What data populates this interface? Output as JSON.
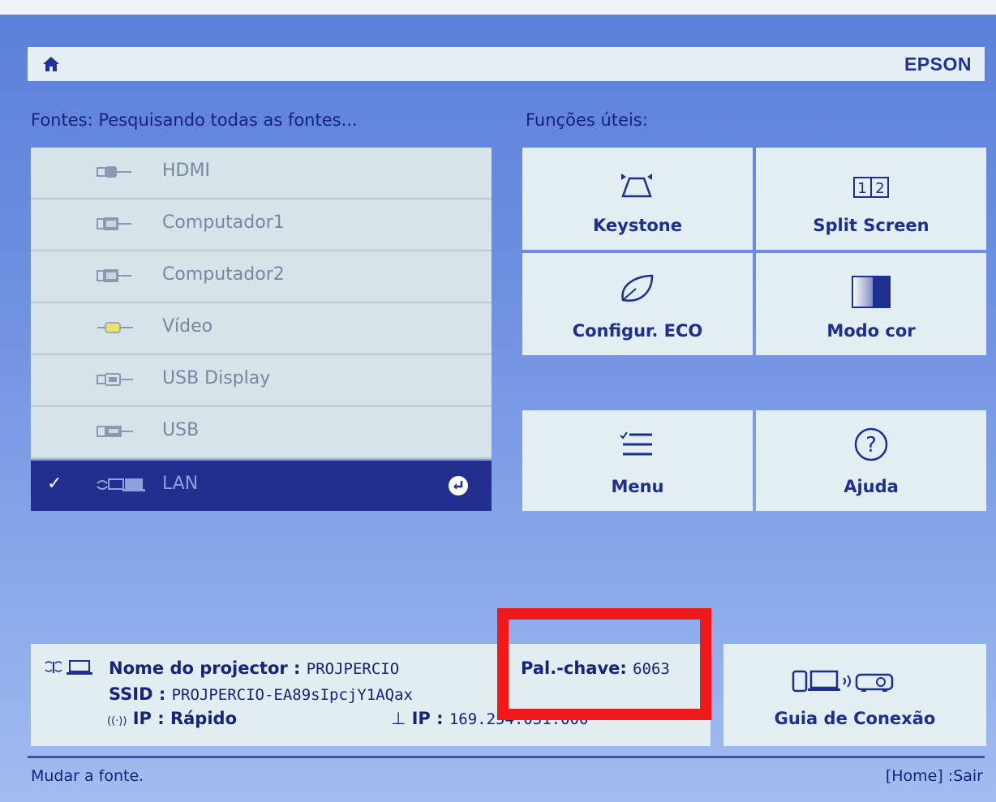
{
  "header": {
    "brand": "EPSON",
    "home_icon": "home-icon"
  },
  "sources": {
    "title": "Fontes: Pesquisando todas as fontes...",
    "items": [
      {
        "label": "HDMI",
        "icon": "hdmi-connector-icon",
        "selected": false
      },
      {
        "label": "Computador1",
        "icon": "vga-connector-icon",
        "selected": false
      },
      {
        "label": "Computador2",
        "icon": "vga-connector-icon",
        "selected": false
      },
      {
        "label": "Vídeo",
        "icon": "rca-video-connector-icon",
        "selected": false
      },
      {
        "label": "USB Display",
        "icon": "usb-connector-icon",
        "selected": false
      },
      {
        "label": "USB",
        "icon": "usb-a-connector-icon",
        "selected": false
      },
      {
        "label": "LAN",
        "icon": "network-computer-icon",
        "selected": true
      }
    ]
  },
  "functions": {
    "title": "Funções úteis:",
    "tiles": [
      {
        "label": "Keystone",
        "icon": "keystone-icon"
      },
      {
        "label": "Split Screen",
        "icon": "split-screen-icon"
      },
      {
        "label": "Configur. ECO",
        "icon": "eco-leaf-icon"
      },
      {
        "label": "Modo cor",
        "icon": "color-mode-icon"
      },
      {
        "label": "Menu",
        "icon": "menu-list-icon"
      },
      {
        "label": "Ajuda",
        "icon": "help-icon"
      }
    ]
  },
  "network": {
    "projector_name_label": "Nome do projector :",
    "projector_name": "PROJPERCIO",
    "ssid_label": "SSID :",
    "ssid": "PROJPERCIO-EA89sIpcjY1AQax",
    "ip_label": "IP : Rápido",
    "ip_wired_label": "IP :",
    "ip_wired": "169.254.031.000",
    "passkey_label": "Pal.-chave:",
    "passkey": "6063"
  },
  "guide": {
    "label": "Guia de Conexão",
    "icon": "connection-guide-icon"
  },
  "footer": {
    "hint": "Mudar a fonte.",
    "exit": "[Home] :Sair"
  },
  "colors": {
    "accent": "#232f8e",
    "highlight_box": "#f01818",
    "tile_bg": "#e2eef2"
  }
}
